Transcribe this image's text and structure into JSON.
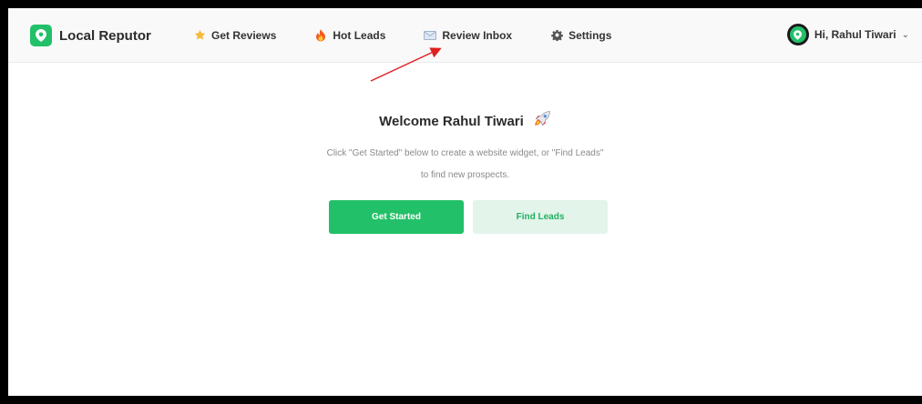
{
  "brand": {
    "name": "Local Reputor"
  },
  "nav": [
    {
      "label": "Get Reviews",
      "icon": "star-icon"
    },
    {
      "label": "Hot Leads",
      "icon": "fire-icon"
    },
    {
      "label": "Review Inbox",
      "icon": "envelope-icon"
    },
    {
      "label": "Settings",
      "icon": "gear-icon"
    }
  ],
  "user": {
    "greeting": "Hi, Rahul Tiwari"
  },
  "welcome": {
    "title": "Welcome Rahul Tiwari",
    "subtitle_line1": "Click \"Get Started\" below to create a website widget, or \"Find Leads\"",
    "subtitle_line2": "to find new prospects."
  },
  "buttons": {
    "get_started": "Get Started",
    "find_leads": "Find Leads"
  },
  "colors": {
    "accent": "#22c068",
    "accent_light": "#e3f4ea",
    "annotation_arrow": "#e02020"
  }
}
